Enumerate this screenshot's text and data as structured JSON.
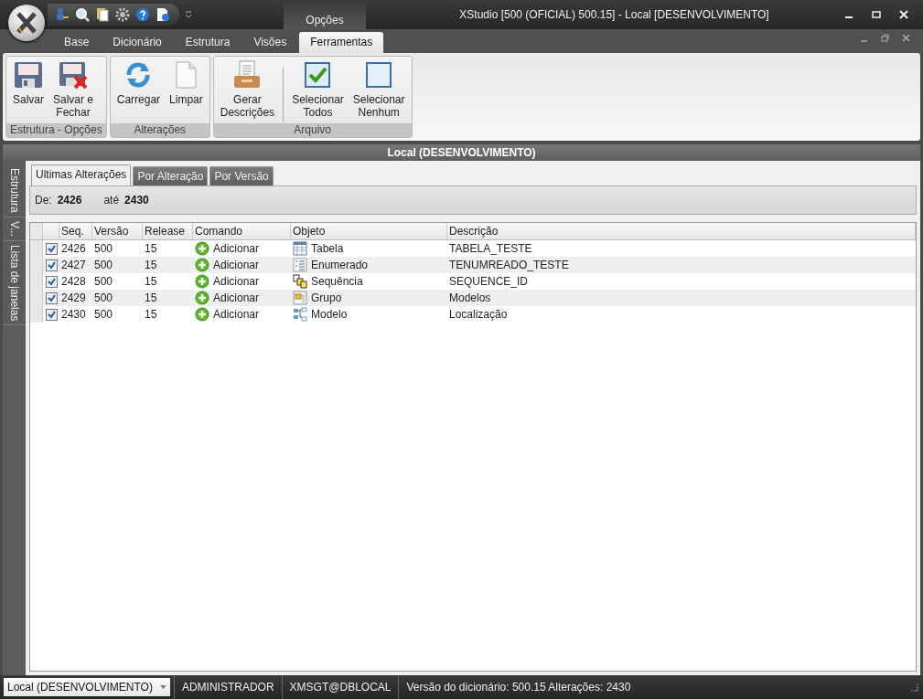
{
  "window": {
    "title": "XStudio [500 (OFICIAL) 500.15] - Local [DESENVOLVIMENTO]"
  },
  "contextual_group": "Opções",
  "ribbon_tabs": [
    {
      "label": "Base",
      "selected": false
    },
    {
      "label": "Dicionário",
      "selected": false
    },
    {
      "label": "Estrutura",
      "selected": false
    },
    {
      "label": "Visões",
      "selected": false
    },
    {
      "label": "Ferramentas",
      "selected": true
    }
  ],
  "ribbon_groups": [
    {
      "title": "Estrutura - Opções",
      "buttons": [
        {
          "kind": "save",
          "lines": [
            "Salvar"
          ]
        },
        {
          "kind": "save-close",
          "lines": [
            "Salvar e",
            "Fechar"
          ]
        }
      ]
    },
    {
      "title": "Alterações",
      "buttons": [
        {
          "kind": "reload",
          "lines": [
            "Carregar"
          ]
        },
        {
          "kind": "clear",
          "lines": [
            "Limpar"
          ]
        }
      ]
    },
    {
      "title": "Arquivo",
      "buttons": [
        {
          "kind": "generate",
          "lines": [
            "Gerar",
            "Descrições"
          ],
          "separator_after": true
        },
        {
          "kind": "select-all",
          "lines": [
            "Selecionar",
            "Todos"
          ]
        },
        {
          "kind": "select-none",
          "lines": [
            "Selecionar",
            "Nenhum"
          ]
        }
      ]
    }
  ],
  "document": {
    "title": "Local (DESENVOLVIMENTO)",
    "side_tabs": [
      "Estrutura",
      "V...",
      "Lista de janelas"
    ],
    "tabs": [
      {
        "label": "Ultimas Alterações",
        "selected": true
      },
      {
        "label": "Por Alteração",
        "selected": false
      },
      {
        "label": "Por Versão",
        "selected": false
      }
    ],
    "filter": {
      "from_label": "De:",
      "from": "2426",
      "to_label": "até",
      "to": "2430"
    },
    "table": {
      "columns": [
        "Seq.",
        "Versão",
        "Release",
        "Comando",
        "Objeto",
        "Descrição"
      ],
      "rows": [
        {
          "checked": true,
          "seq": "2426",
          "version": "500",
          "release": "15",
          "command": "Adicionar",
          "object": "Tabela",
          "kind": "table",
          "description": "TABELA_TESTE"
        },
        {
          "checked": true,
          "seq": "2427",
          "version": "500",
          "release": "15",
          "command": "Adicionar",
          "object": "Enumerado",
          "kind": "enum",
          "description": "TENUMREADO_TESTE"
        },
        {
          "checked": true,
          "seq": "2428",
          "version": "500",
          "release": "15",
          "command": "Adicionar",
          "object": "Sequência",
          "kind": "sequence",
          "description": "SEQUENCE_ID"
        },
        {
          "checked": true,
          "seq": "2429",
          "version": "500",
          "release": "15",
          "command": "Adicionar",
          "object": "Grupo",
          "kind": "group",
          "description": "Modelos"
        },
        {
          "checked": true,
          "seq": "2430",
          "version": "500",
          "release": "15",
          "command": "Adicionar",
          "object": "Modelo",
          "kind": "model",
          "description": "Localização"
        }
      ]
    }
  },
  "status_bar": {
    "connection": "Local (DESENVOLVIMENTO)",
    "user": "ADMINISTRADOR",
    "database": "XMSGT@DBLOCAL",
    "info": "Versão do dicionário: 500.15 Alterações: 2430"
  }
}
